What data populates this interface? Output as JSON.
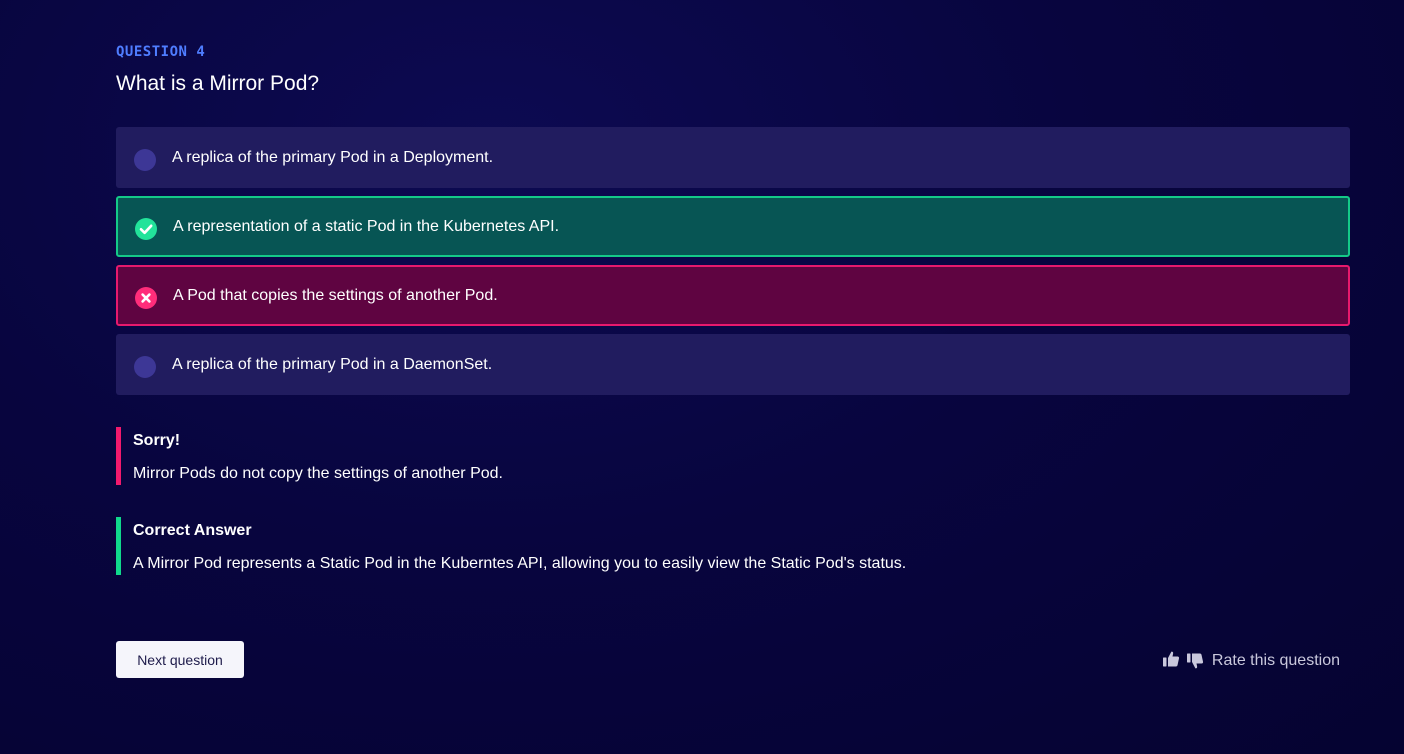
{
  "question": {
    "label": "QUESTION 4",
    "text": "What is a Mirror Pod?"
  },
  "options": [
    {
      "text": "A replica of the primary Pod in a Deployment.",
      "state": "unselected"
    },
    {
      "text": "A representation of a static Pod in the Kubernetes API.",
      "state": "correct"
    },
    {
      "text": "A Pod that copies the settings of another Pod.",
      "state": "incorrect-selected"
    },
    {
      "text": "A replica of the primary Pod in a DaemonSet.",
      "state": "unselected"
    }
  ],
  "feedback": {
    "sorry": {
      "title": "Sorry!",
      "body": "Mirror Pods do not copy the settings of another Pod."
    },
    "correct": {
      "title": "Correct Answer",
      "body": "A Mirror Pod represents a Static Pod in the Kuberntes API, allowing you to easily view the Static Pod's status."
    }
  },
  "actions": {
    "next_label": "Next question",
    "rate_label": "Rate this question"
  },
  "icons": {
    "correct": "check-circle-icon",
    "incorrect": "x-circle-icon",
    "thumbs_up": "thumbs-up-icon",
    "thumbs_down": "thumbs-down-icon"
  },
  "colors": {
    "question_label": "#4f7dff",
    "option_bg": "#211c5f",
    "correct_bg": "#075554",
    "correct_border": "#14c988",
    "wrong_bg": "#5f0441",
    "wrong_border": "#e7196d",
    "sorry_bar": "#f2196d",
    "correct_bar": "#10d98c"
  }
}
